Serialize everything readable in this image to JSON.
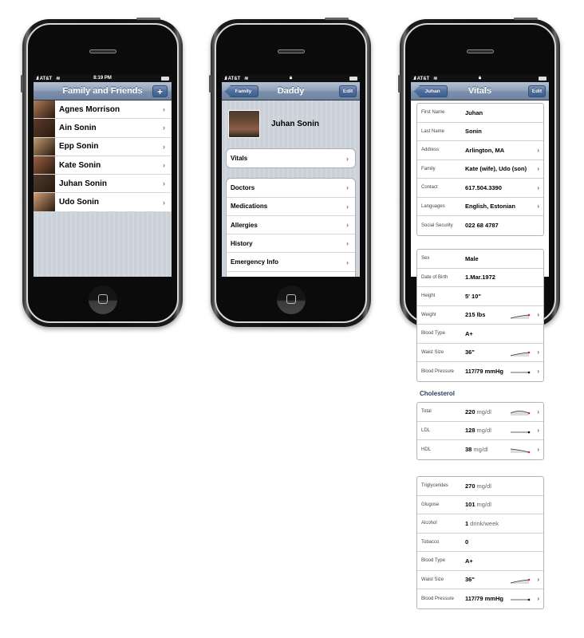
{
  "phones": [
    {
      "status": {
        "carrier": "AT&T",
        "center": "8:19 PM"
      },
      "nav": {
        "title": "Family and Friends",
        "right_button": "+"
      },
      "contacts": [
        {
          "name": "Agnes Morrison",
          "photo_color": "#b07a55"
        },
        {
          "name": "Ain Sonin",
          "photo_color": "#5a3a2a"
        },
        {
          "name": "Epp Sonin",
          "photo_color": "#c09a70"
        },
        {
          "name": "Kate Sonin",
          "photo_color": "#9a6040"
        },
        {
          "name": "Juhan Sonin",
          "photo_color": "#4a3a30"
        },
        {
          "name": "Udo Sonin",
          "photo_color": "#d0a078"
        }
      ]
    },
    {
      "status": {
        "carrier": "AT&T",
        "center": "lock"
      },
      "nav": {
        "back_button": "Family",
        "title": "Daddy",
        "right_button": "Edit"
      },
      "profile": {
        "name": "Juhan Sonin"
      },
      "vitals_item": "Vitals",
      "menu": [
        "Doctors",
        "Medications",
        "Allergies",
        "History",
        "Emergency Info"
      ]
    },
    {
      "status": {
        "carrier": "AT&T",
        "center": "lock"
      },
      "nav": {
        "back_button": "Juhan",
        "title": "Vitals",
        "right_button": "Edit"
      }
    }
  ],
  "vitals": {
    "identity": [
      {
        "label": "First Name",
        "value": "Juhan",
        "chevron": false
      },
      {
        "label": "Last Name",
        "value": "Sonin",
        "chevron": false
      },
      {
        "label": "Address",
        "value": "Arlington, MA",
        "chevron": true
      },
      {
        "label": "Family",
        "value": "Kate (wife), Udo (son)",
        "chevron": true
      },
      {
        "label": "Contact",
        "value": "617.504.3390",
        "chevron": true
      },
      {
        "label": "Languages",
        "value": "English, Estonian",
        "chevron": true
      },
      {
        "label": "Social Security",
        "value": "022 68 4787",
        "chevron": false
      }
    ],
    "body": [
      {
        "label": "Sex",
        "value": "Male",
        "chevron": false
      },
      {
        "label": "Date of Birth",
        "value": "1.Mar.1972",
        "chevron": false
      },
      {
        "label": "Height",
        "value": "5' 10\"",
        "chevron": false
      },
      {
        "label": "Weight",
        "value": "215 lbs",
        "chevron": true,
        "trend": "up"
      },
      {
        "label": "Blood Type",
        "value": "A+",
        "chevron": false
      },
      {
        "label": "Waist Size",
        "value": "36\"",
        "chevron": true,
        "trend": "up"
      },
      {
        "label": "Blood Pressure",
        "value": "117/79 mmHg",
        "chevron": true,
        "trend": "flat"
      }
    ],
    "cholesterol_heading": "Cholesterol",
    "cholesterol": [
      {
        "label": "Total",
        "value": "220",
        "unit": "mg/dl",
        "chevron": true,
        "trend": "arc"
      },
      {
        "label": "LDL",
        "value": "128",
        "unit": "mg/dl",
        "chevron": true,
        "trend": "flat"
      },
      {
        "label": "HDL",
        "value": "38",
        "unit": "mg/dl",
        "chevron": true,
        "trend": "down"
      }
    ],
    "other": [
      {
        "label": "Triglycerides",
        "value": "270",
        "unit": "mg/dl",
        "chevron": false
      },
      {
        "label": "Glugose",
        "value": "101",
        "unit": "mg/dl",
        "chevron": false
      },
      {
        "label": "Alcohol",
        "value": "1",
        "unit": "drink/week",
        "chevron": false
      },
      {
        "label": "Tobacco",
        "value": "0",
        "chevron": false
      },
      {
        "label": "Blood Type",
        "value": "A+",
        "chevron": false
      },
      {
        "label": "Waist Size",
        "value": "36\"",
        "chevron": true,
        "trend": "up"
      },
      {
        "label": "Blood Pressure",
        "value": "117/79 mmHg",
        "chevron": true,
        "trend": "flat"
      }
    ]
  },
  "colors": {
    "nav_top": "#b5c1d2",
    "nav_bottom": "#6f84a2",
    "section_heading": "#2e3e5a",
    "trend_dot": "#e02020"
  }
}
